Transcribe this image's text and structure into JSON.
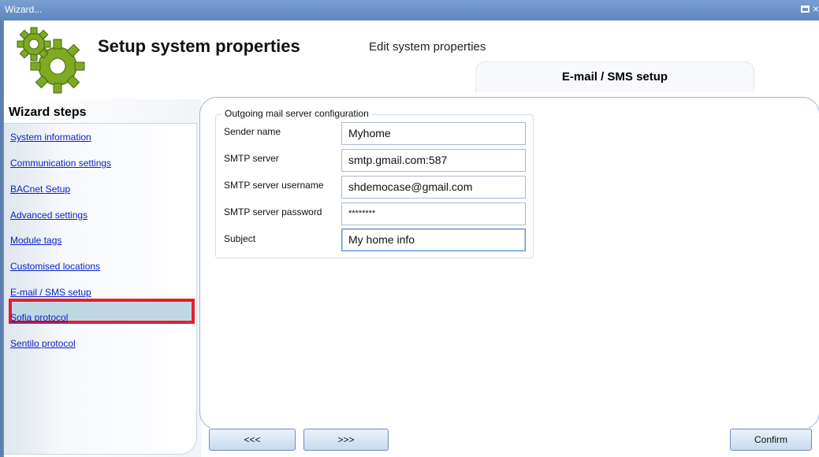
{
  "window": {
    "title": "Wizard..."
  },
  "header": {
    "main_title": "Setup system properties",
    "sub_title": "Edit system properties",
    "tab_label": "E-mail / SMS setup"
  },
  "sidebar": {
    "title": "Wizard steps",
    "items": [
      {
        "label": "System information"
      },
      {
        "label": "Communication settings"
      },
      {
        "label": "BACnet Setup"
      },
      {
        "label": "Advanced settings"
      },
      {
        "label": "Module tags"
      },
      {
        "label": "Customised locations"
      },
      {
        "label": "E-mail / SMS setup",
        "selected": true
      },
      {
        "label": "Sofia protocol"
      },
      {
        "label": "Sentilo protocol"
      }
    ]
  },
  "form": {
    "group_title": "Outgoing mail server configuration",
    "fields": [
      {
        "label": "Sender name",
        "value": "Myhome"
      },
      {
        "label": "SMTP server",
        "value": "smtp.gmail.com:587"
      },
      {
        "label": "SMTP server  username",
        "value": "shdemocase@gmail.com"
      },
      {
        "label": "SMTP server password",
        "value": "********"
      },
      {
        "label": "Subject",
        "value": "My home info"
      }
    ]
  },
  "buttons": {
    "prev": "<<<",
    "next": ">>>",
    "confirm": "Confirm"
  },
  "colors": {
    "titlebar": "#5d86bf",
    "link": "#0b22c8",
    "selected_bg": "#bfd8e4",
    "highlight_border": "#e02030",
    "gear": "#8bb52a"
  },
  "icons": {
    "logo": "gear-icon",
    "window": "restore-icon",
    "close": "close-icon"
  }
}
